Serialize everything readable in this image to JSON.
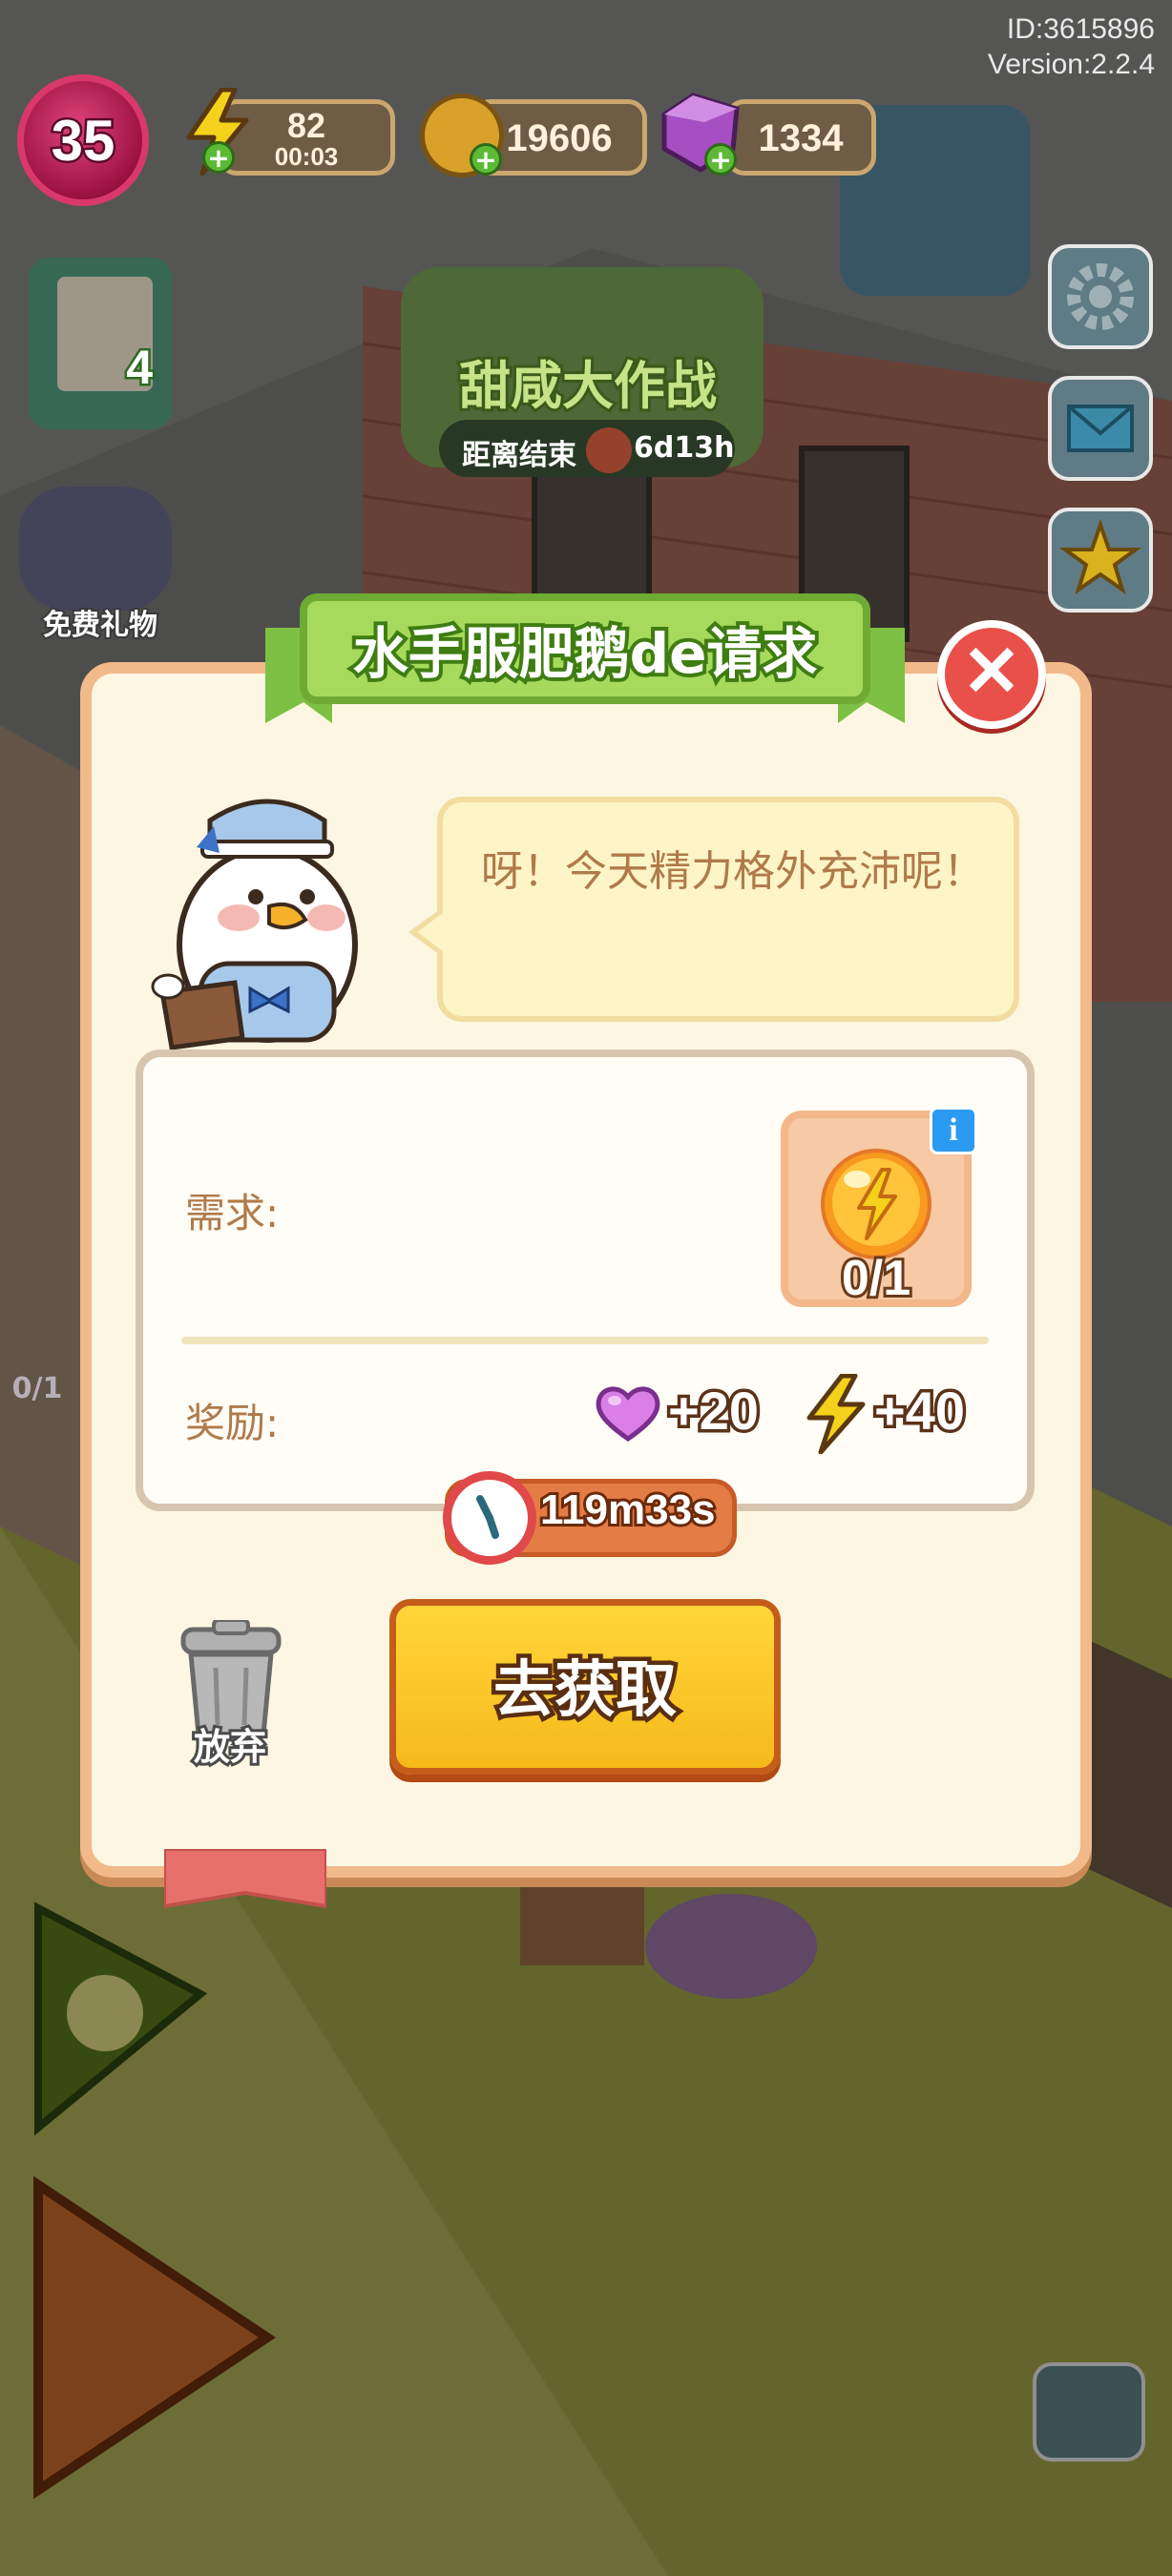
{
  "hud": {
    "id_text": "ID:3615896",
    "version_text": "Version:2.2.4",
    "level": "35",
    "energy": "82",
    "energy_timer": "00:03",
    "coins": "19606",
    "gems": "1334",
    "clover_count": "4",
    "free_gift_label": "免费礼物",
    "event_title": "甜咸大作战",
    "event_countdown_label": "距离结束",
    "event_countdown": "6d13h"
  },
  "side_buttons": [
    "gear-icon",
    "mail-icon",
    "trophy-icon"
  ],
  "popup": {
    "title": "水手服肥鹅de请求",
    "close_glyph": "✕",
    "dialogue": "呀！今天精力格外充沛呢！",
    "requirement_label": "需求:",
    "requirement_count": "0/1",
    "reward_label": "奖励:",
    "rewards": [
      {
        "icon": "heart-icon",
        "amount": "+20"
      },
      {
        "icon": "lightning-icon",
        "amount": "+40"
      }
    ],
    "timer": "119m33s",
    "action_button": "去获取",
    "discard_label": "放弃"
  },
  "background_items": {
    "left_badge_count": "0/1"
  },
  "colors": {
    "popup_bg": "#fdf6e2",
    "popup_border": "#f2b98b",
    "title_green": "#9bd256",
    "button_yellow": "#ffd63a",
    "close_red": "#e9504a"
  }
}
